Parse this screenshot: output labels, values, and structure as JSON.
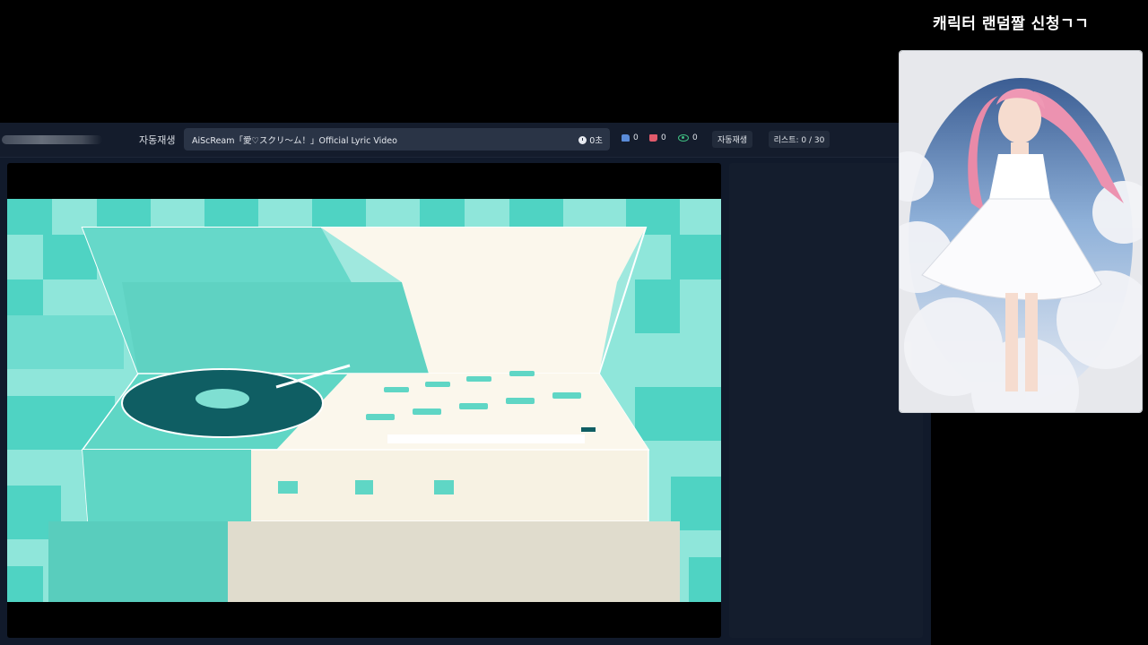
{
  "overlay": {
    "title": "캐릭터 랜덤짤 신청ㄱㄱ"
  },
  "topbar": {
    "autoplay_label": "자동재생",
    "now_playing": {
      "title": "AiScReam「愛♡スクリ～ム！」Official Lyric Video",
      "time": "0초"
    },
    "likes": "0",
    "dislikes": "0",
    "views": "0",
    "autoplay_button": "자동재생",
    "list_counter": "리스트: 0 / 30"
  },
  "icons": [
    "clock-icon",
    "thumbs-up-icon",
    "thumbs-down-icon",
    "eye-icon"
  ],
  "colors": {
    "accent": "#5a8bd8",
    "dislike": "#e05a6b",
    "views": "#3fbf82",
    "video_teal": "#5fd6c5",
    "video_cream": "#f8f5ea"
  }
}
